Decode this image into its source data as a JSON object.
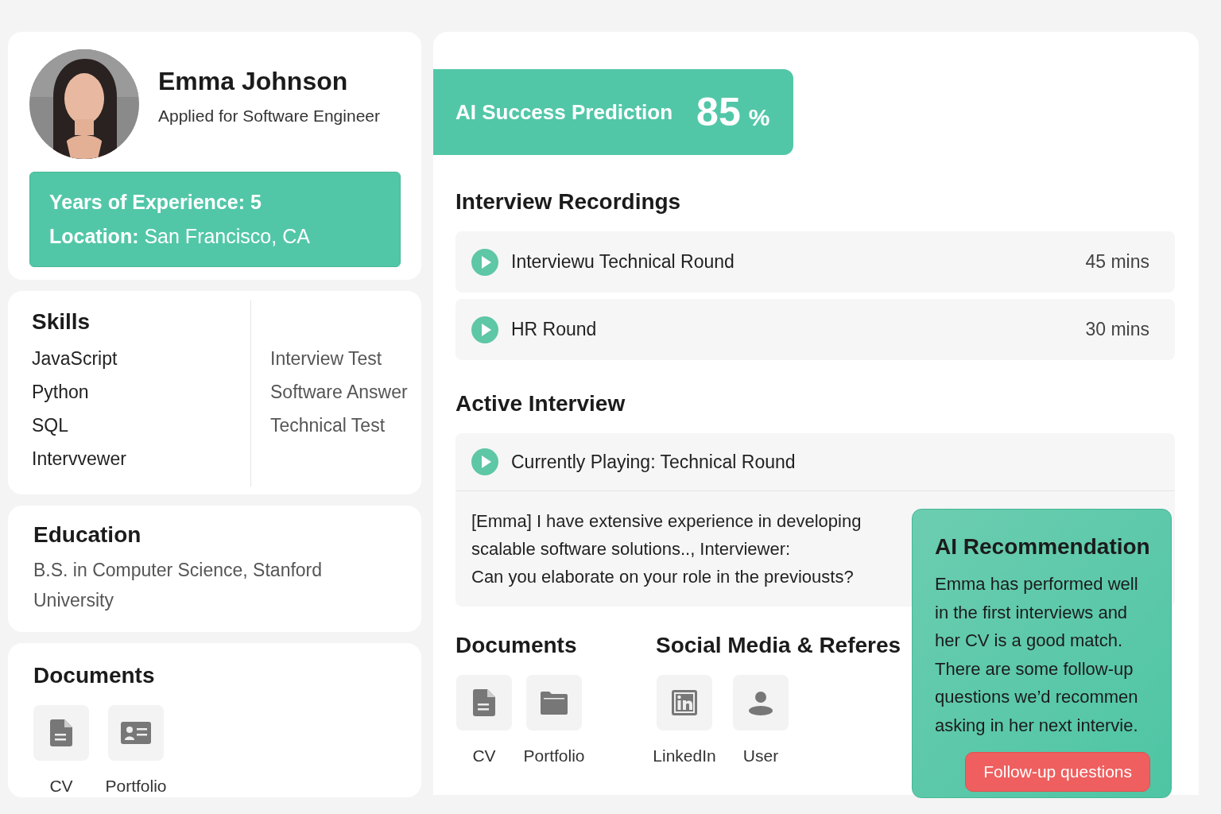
{
  "profile": {
    "name": "Emma Johnson",
    "subtitle": "Applied for Software Engineer",
    "experience": "Years of Experience: 5",
    "location": "**Location:** San Francisco, CA"
  },
  "skills": {
    "title": "Skills",
    "items": [
      "JavaScript",
      "Python",
      "SQL",
      "Intervvewer"
    ],
    "column_2": [
      "Interview Test",
      "Software Answer",
      "Technical Test"
    ]
  },
  "education": {
    "title": "Education",
    "text": "B.S. in Computer Science, Stanford University"
  },
  "documents_left": {
    "title": "Documents",
    "items": [
      {
        "label": "CV",
        "kind": "document"
      },
      {
        "label": "Portfolio",
        "kind": "id-card"
      }
    ]
  },
  "prediction": {
    "label": "AI Success Prediction",
    "value": "85",
    "unit": "%"
  },
  "recordings": {
    "title": "Interview Recordings",
    "items": [
      {
        "title": "Interviewu Technical Round",
        "duration": "45 mins"
      },
      {
        "title": "HR Round",
        "duration": "30 mins"
      }
    ]
  },
  "active_interview": {
    "title": "Active Interview",
    "now_playing": "Currently Playing: Technical Round",
    "transcript": "[Emma] I have extensive experience in developing\nscalable software solutions.., Interviewer:\nCan you elaborate on your role in the previousts?"
  },
  "documents_right": {
    "title": "Documents",
    "items": [
      {
        "label": "CV",
        "kind": "document"
      },
      {
        "label": "Portfolio",
        "kind": "folder"
      }
    ]
  },
  "social": {
    "title": "Social Media & Referes",
    "items": [
      {
        "label": "LinkedIn",
        "kind": "linkedin"
      },
      {
        "label": "User",
        "kind": "user"
      }
    ]
  },
  "recommendation": {
    "title": "AI Recommendation",
    "text": "Emma has performed well in the first interviews and her CV is a good match. There are some follow-up questions we’d recommen asking in her next intervie.",
    "button": "Follow-up questions"
  }
}
